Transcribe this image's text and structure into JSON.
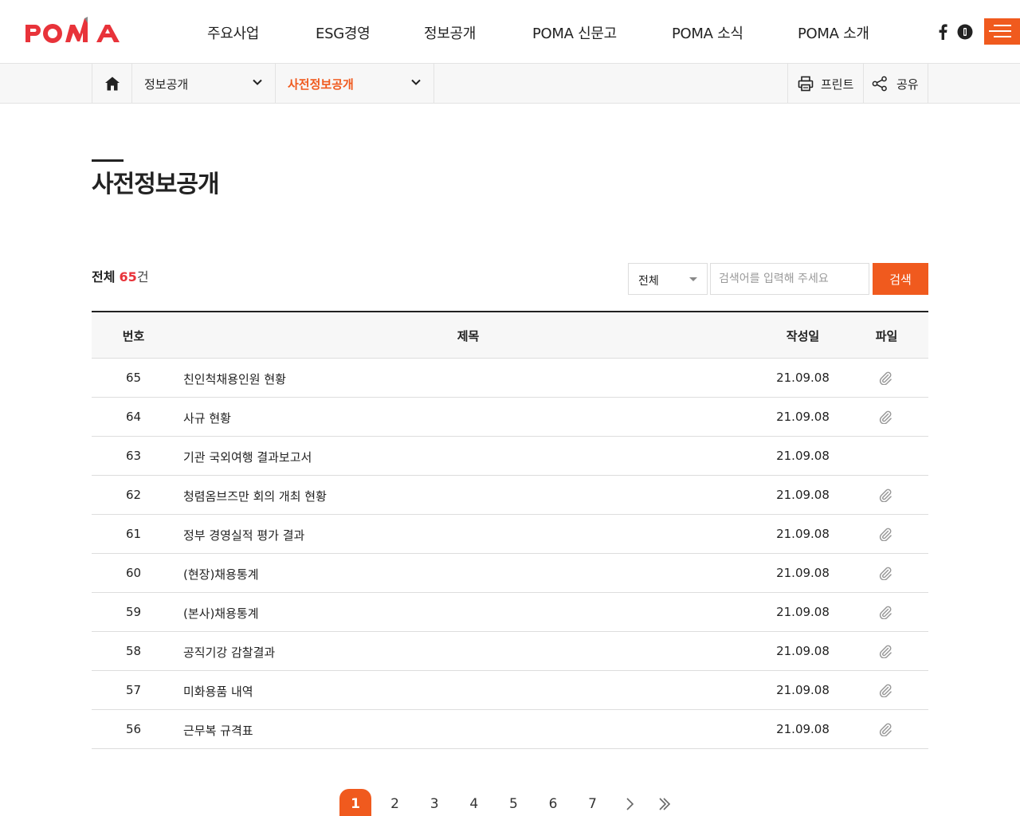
{
  "header": {
    "logo_text": "POMA",
    "brand_color": "#f05a1e",
    "nav": [
      "주요사업",
      "ESG경영",
      "정보공개",
      "POMA 신문고",
      "POMA 소식",
      "POMA 소개"
    ],
    "sns": [
      "facebook-icon",
      "blog-icon"
    ],
    "menu_icon": "hamburger-icon"
  },
  "location": {
    "home_icon": "home-icon",
    "depth1": "정보공개",
    "depth2": "사전정보공개",
    "print_label": "프린트",
    "share_label": "공유"
  },
  "page": {
    "title": "사전정보공개"
  },
  "list": {
    "count_label": "전체",
    "count": "65",
    "count_unit": "건",
    "search_select": "전체",
    "search_placeholder": "검색어를 입력해 주세요",
    "search_button": "검색",
    "columns": [
      "번호",
      "제목",
      "작성일",
      "파일"
    ],
    "rows": [
      {
        "no": "65",
        "title": "친인척채용인원 현황",
        "date": "21.09.08",
        "file": true
      },
      {
        "no": "64",
        "title": "사규 현황",
        "date": "21.09.08",
        "file": true
      },
      {
        "no": "63",
        "title": "기관 국외여행 결과보고서",
        "date": "21.09.08",
        "file": false
      },
      {
        "no": "62",
        "title": "청렴옴브즈만 회의 개최 현황",
        "date": "21.09.08",
        "file": true
      },
      {
        "no": "61",
        "title": "정부 경영실적 평가 결과",
        "date": "21.09.08",
        "file": true
      },
      {
        "no": "60",
        "title": "(현장)채용통계",
        "date": "21.09.08",
        "file": true
      },
      {
        "no": "59",
        "title": "(본사)채용통계",
        "date": "21.09.08",
        "file": true
      },
      {
        "no": "58",
        "title": "공직기강 감찰결과",
        "date": "21.09.08",
        "file": true
      },
      {
        "no": "57",
        "title": "미화용품 내역",
        "date": "21.09.08",
        "file": true
      },
      {
        "no": "56",
        "title": "근무복 규격표",
        "date": "21.09.08",
        "file": true
      }
    ]
  },
  "pagination": {
    "pages": [
      "1",
      "2",
      "3",
      "4",
      "5",
      "6",
      "7"
    ],
    "current": "1",
    "next_icon": "chevron-right-icon",
    "last_icon": "double-chevron-right-icon"
  }
}
